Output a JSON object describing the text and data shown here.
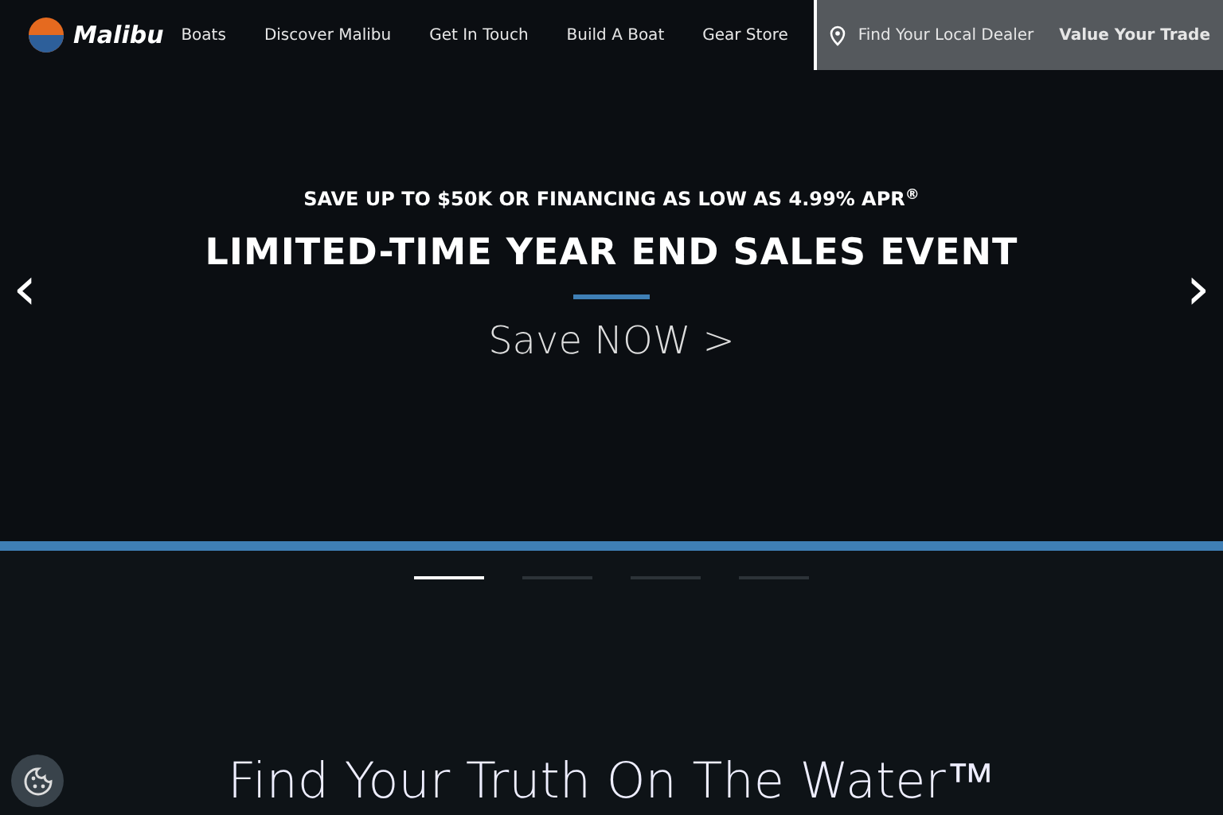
{
  "logo": {
    "text": "Malibu"
  },
  "nav": [
    {
      "label": "Boats"
    },
    {
      "label": "Discover Malibu"
    },
    {
      "label": "Get In Touch"
    },
    {
      "label": "Build A Boat"
    },
    {
      "label": "Gear Store"
    }
  ],
  "dealer_link": "Find Your Local Dealer",
  "trade_link": "Value Your Trade",
  "hero": {
    "eyebrow": "SAVE UP TO $50K OR FINANCING AS LOW AS 4.99% APR$^{®}$",
    "title": "LIMITED-TIME YEAR END SALES EVENT",
    "cta": "Save NOW >",
    "prev": "‹",
    "next": "›"
  },
  "indicators": [
    {
      "selected": true
    },
    {
      "selected": false
    },
    {
      "selected": false
    },
    {
      "selected": false
    }
  ],
  "section_title": "Find Your Truth On The Water™"
}
